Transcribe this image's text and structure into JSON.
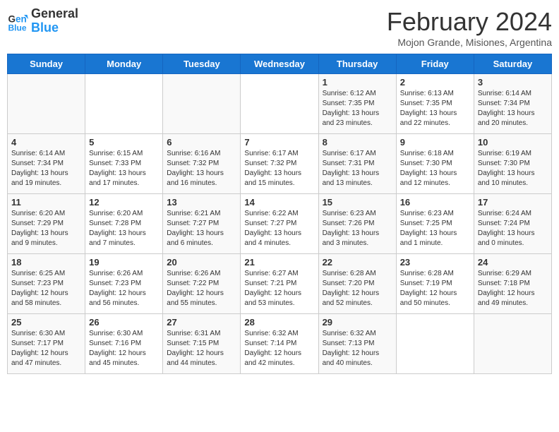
{
  "header": {
    "logo_line1": "General",
    "logo_line2": "Blue",
    "month_title": "February 2024",
    "location": "Mojon Grande, Misiones, Argentina"
  },
  "days_of_week": [
    "Sunday",
    "Monday",
    "Tuesday",
    "Wednesday",
    "Thursday",
    "Friday",
    "Saturday"
  ],
  "weeks": [
    [
      {
        "num": "",
        "info": ""
      },
      {
        "num": "",
        "info": ""
      },
      {
        "num": "",
        "info": ""
      },
      {
        "num": "",
        "info": ""
      },
      {
        "num": "1",
        "info": "Sunrise: 6:12 AM\nSunset: 7:35 PM\nDaylight: 13 hours\nand 23 minutes."
      },
      {
        "num": "2",
        "info": "Sunrise: 6:13 AM\nSunset: 7:35 PM\nDaylight: 13 hours\nand 22 minutes."
      },
      {
        "num": "3",
        "info": "Sunrise: 6:14 AM\nSunset: 7:34 PM\nDaylight: 13 hours\nand 20 minutes."
      }
    ],
    [
      {
        "num": "4",
        "info": "Sunrise: 6:14 AM\nSunset: 7:34 PM\nDaylight: 13 hours\nand 19 minutes."
      },
      {
        "num": "5",
        "info": "Sunrise: 6:15 AM\nSunset: 7:33 PM\nDaylight: 13 hours\nand 17 minutes."
      },
      {
        "num": "6",
        "info": "Sunrise: 6:16 AM\nSunset: 7:32 PM\nDaylight: 13 hours\nand 16 minutes."
      },
      {
        "num": "7",
        "info": "Sunrise: 6:17 AM\nSunset: 7:32 PM\nDaylight: 13 hours\nand 15 minutes."
      },
      {
        "num": "8",
        "info": "Sunrise: 6:17 AM\nSunset: 7:31 PM\nDaylight: 13 hours\nand 13 minutes."
      },
      {
        "num": "9",
        "info": "Sunrise: 6:18 AM\nSunset: 7:30 PM\nDaylight: 13 hours\nand 12 minutes."
      },
      {
        "num": "10",
        "info": "Sunrise: 6:19 AM\nSunset: 7:30 PM\nDaylight: 13 hours\nand 10 minutes."
      }
    ],
    [
      {
        "num": "11",
        "info": "Sunrise: 6:20 AM\nSunset: 7:29 PM\nDaylight: 13 hours\nand 9 minutes."
      },
      {
        "num": "12",
        "info": "Sunrise: 6:20 AM\nSunset: 7:28 PM\nDaylight: 13 hours\nand 7 minutes."
      },
      {
        "num": "13",
        "info": "Sunrise: 6:21 AM\nSunset: 7:27 PM\nDaylight: 13 hours\nand 6 minutes."
      },
      {
        "num": "14",
        "info": "Sunrise: 6:22 AM\nSunset: 7:27 PM\nDaylight: 13 hours\nand 4 minutes."
      },
      {
        "num": "15",
        "info": "Sunrise: 6:23 AM\nSunset: 7:26 PM\nDaylight: 13 hours\nand 3 minutes."
      },
      {
        "num": "16",
        "info": "Sunrise: 6:23 AM\nSunset: 7:25 PM\nDaylight: 13 hours\nand 1 minute."
      },
      {
        "num": "17",
        "info": "Sunrise: 6:24 AM\nSunset: 7:24 PM\nDaylight: 13 hours\nand 0 minutes."
      }
    ],
    [
      {
        "num": "18",
        "info": "Sunrise: 6:25 AM\nSunset: 7:23 PM\nDaylight: 12 hours\nand 58 minutes."
      },
      {
        "num": "19",
        "info": "Sunrise: 6:26 AM\nSunset: 7:23 PM\nDaylight: 12 hours\nand 56 minutes."
      },
      {
        "num": "20",
        "info": "Sunrise: 6:26 AM\nSunset: 7:22 PM\nDaylight: 12 hours\nand 55 minutes."
      },
      {
        "num": "21",
        "info": "Sunrise: 6:27 AM\nSunset: 7:21 PM\nDaylight: 12 hours\nand 53 minutes."
      },
      {
        "num": "22",
        "info": "Sunrise: 6:28 AM\nSunset: 7:20 PM\nDaylight: 12 hours\nand 52 minutes."
      },
      {
        "num": "23",
        "info": "Sunrise: 6:28 AM\nSunset: 7:19 PM\nDaylight: 12 hours\nand 50 minutes."
      },
      {
        "num": "24",
        "info": "Sunrise: 6:29 AM\nSunset: 7:18 PM\nDaylight: 12 hours\nand 49 minutes."
      }
    ],
    [
      {
        "num": "25",
        "info": "Sunrise: 6:30 AM\nSunset: 7:17 PM\nDaylight: 12 hours\nand 47 minutes."
      },
      {
        "num": "26",
        "info": "Sunrise: 6:30 AM\nSunset: 7:16 PM\nDaylight: 12 hours\nand 45 minutes."
      },
      {
        "num": "27",
        "info": "Sunrise: 6:31 AM\nSunset: 7:15 PM\nDaylight: 12 hours\nand 44 minutes."
      },
      {
        "num": "28",
        "info": "Sunrise: 6:32 AM\nSunset: 7:14 PM\nDaylight: 12 hours\nand 42 minutes."
      },
      {
        "num": "29",
        "info": "Sunrise: 6:32 AM\nSunset: 7:13 PM\nDaylight: 12 hours\nand 40 minutes."
      },
      {
        "num": "",
        "info": ""
      },
      {
        "num": "",
        "info": ""
      }
    ]
  ]
}
